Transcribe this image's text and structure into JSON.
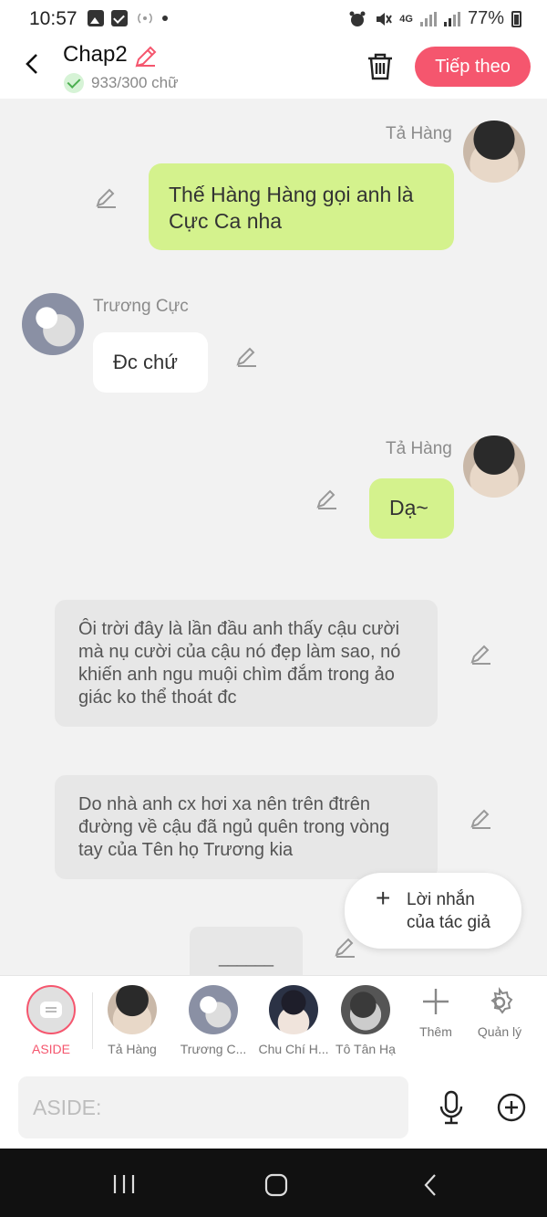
{
  "status": {
    "time": "10:57",
    "net": "4G",
    "battery": "77%"
  },
  "header": {
    "title": "Chap2",
    "word_count": "933/300 chữ",
    "next_label": "Tiếp theo"
  },
  "messages": [
    {
      "sender": "Tả Hàng",
      "text": "Thế Hàng Hàng gọi anh là Cực Ca nha"
    },
    {
      "sender": "Trương Cực",
      "text": "Đc chứ"
    },
    {
      "sender": "Tả Hàng",
      "text": "Dạ~"
    }
  ],
  "narrations": [
    "Ôi trời đây là lần đầu anh thấy cậu cười mà nụ cười của cậu nó đẹp làm sao, nó khiến anh ngu muội chìm đắm trong ảo giác ko thể thoát đc",
    "Do nhà anh cx hơi xa nên trên đtrên đường về cậu đã ngủ quên trong vòng tay của Tên họ Trương kia"
  ],
  "stub_text": "______",
  "fab": {
    "line1": "Lời nhắn",
    "line2": "của tác giả"
  },
  "characters": [
    "ASIDE",
    "Tả Hàng",
    "Trương C...",
    "Chu Chí H...",
    "Tô Tân Hạ"
  ],
  "tools": {
    "add": "Thêm",
    "manage": "Quản lý"
  },
  "input": {
    "placeholder": "ASIDE:"
  },
  "colors": {
    "accent": "#f5566e",
    "bubble_green": "#d4f28d"
  }
}
